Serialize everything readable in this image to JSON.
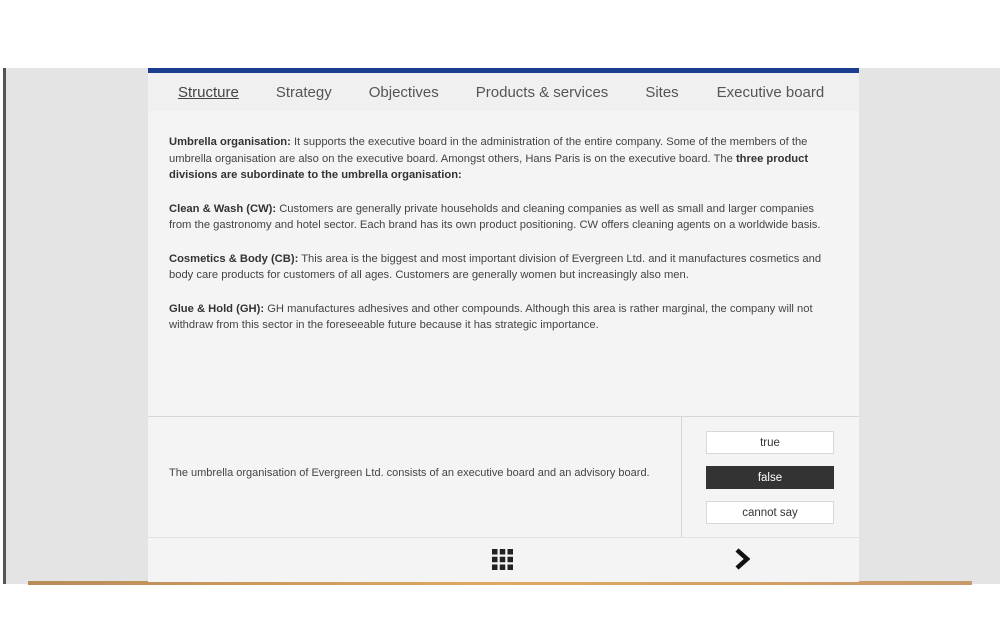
{
  "tabs": [
    {
      "label": "Structure",
      "active": true
    },
    {
      "label": "Strategy",
      "active": false
    },
    {
      "label": "Objectives",
      "active": false
    },
    {
      "label": "Products & services",
      "active": false
    },
    {
      "label": "Sites",
      "active": false
    },
    {
      "label": "Executive board",
      "active": false
    }
  ],
  "content": {
    "p1": {
      "title": "Umbrella organisation:",
      "text": " It supports the executive board in the administration of the entire company. Some of the members of the umbrella organisation are also on the executive board. Amongst others, Hans Paris is on the executive board. The ",
      "bold_tail": "three product divisions are subordinate to the umbrella organisation:"
    },
    "p2": {
      "title": "Clean & Wash (CW):",
      "text": " Customers are generally private households and cleaning companies as well as small and larger companies from the gastronomy and hotel sector. Each brand has its own product positioning. CW offers cleaning agents on a worldwide basis."
    },
    "p3": {
      "title": "Cosmetics & Body (CB):",
      "text": " This area is the biggest and most important division of Evergreen Ltd. and it manufactures cosmetics and body care products for customers of all ages. Customers are generally women but increasingly also men."
    },
    "p4": {
      "title": "Glue & Hold (GH):",
      "text": " GH manufactures adhesives and other compounds. Although this area is rather marginal, the company will not withdraw from this sector in the foreseeable future because it has strategic importance."
    }
  },
  "question": {
    "statement": "The umbrella organisation of Evergreen Ltd. consists of an executive board and an advisory board.",
    "answers": {
      "true": "true",
      "false": "false",
      "cannot_say": "cannot say"
    },
    "selected": "false"
  },
  "footer": {
    "grid_icon": "grid-menu-icon",
    "next_icon": "chevron-right-icon"
  },
  "colors": {
    "accent_bar": "#1a3d8f",
    "selected_answer": "#333333"
  }
}
